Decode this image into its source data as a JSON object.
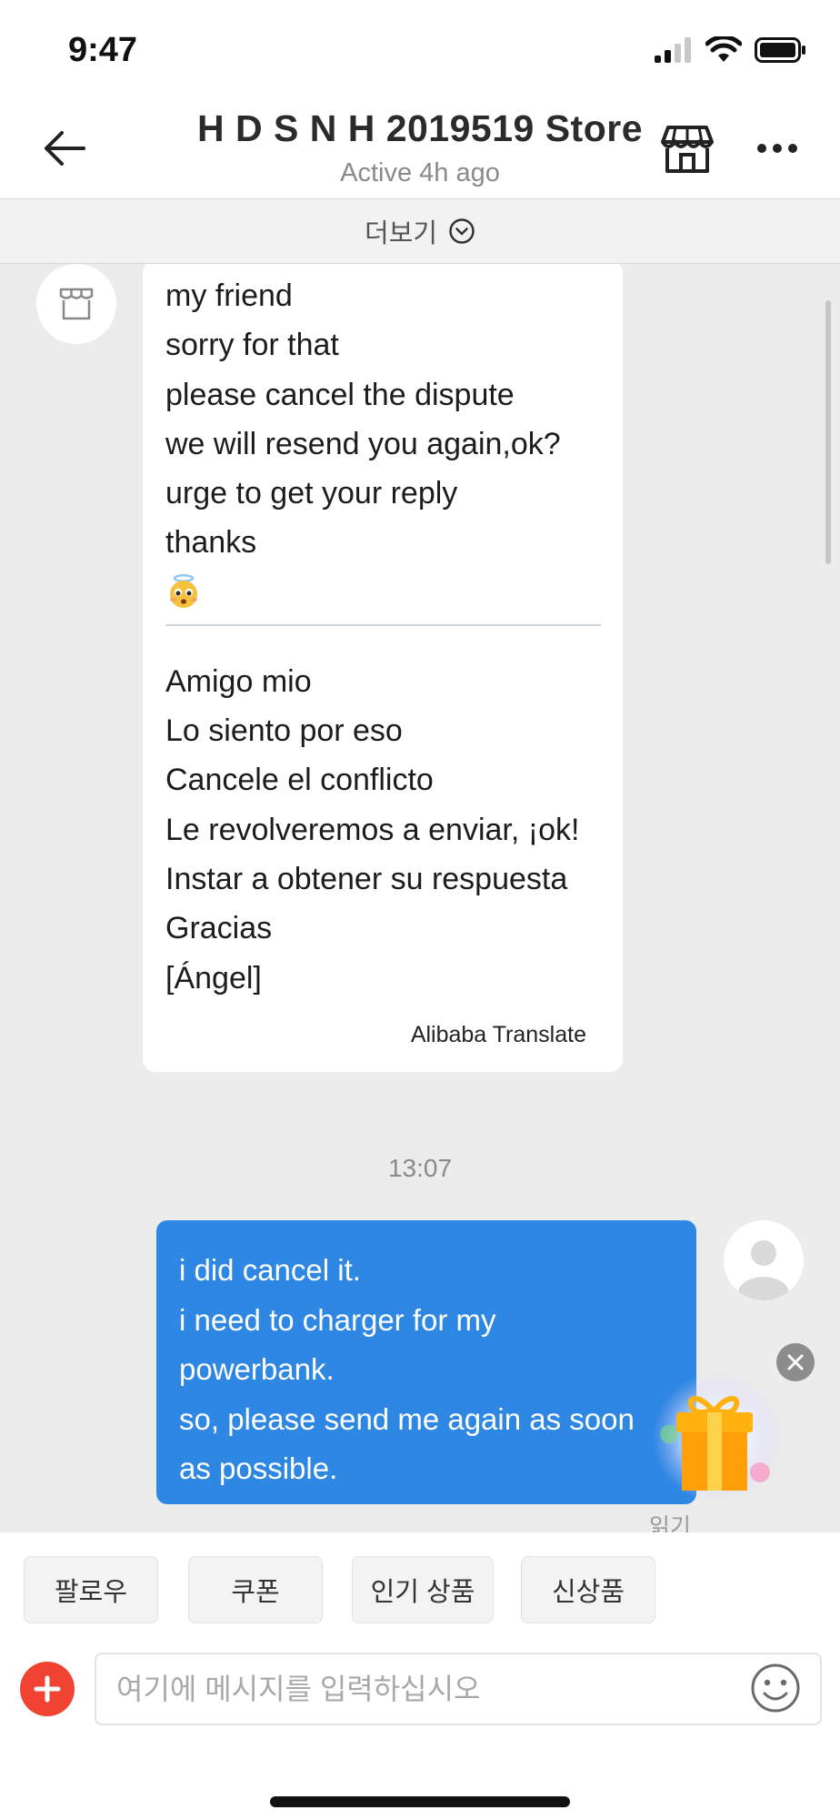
{
  "status_bar": {
    "time": "9:47"
  },
  "header": {
    "store_name": "H D S N H 2019519 Store",
    "active_status": "Active 4h ago"
  },
  "more_bar": {
    "label": "더보기"
  },
  "messages": {
    "incoming": {
      "original_lines": [
        "my friend",
        "sorry for that",
        "please cancel the dispute",
        "we will resend you again,ok?",
        "urge to get your reply",
        "thanks"
      ],
      "translated_lines": [
        "Amigo mio",
        "Lo siento por eso",
        "Cancele el conflicto",
        "Le revolveremos a enviar, ¡ok!",
        "Instar a obtener su respuesta",
        "Gracias",
        "[Ángel]"
      ],
      "translation_credit": "Alibaba Translate"
    },
    "timestamp": "13:07",
    "outgoing": {
      "lines": [
        "i did cancel it.",
        "i need to charger for my",
        "powerbank.",
        "so, please send me again as soon",
        "as possible."
      ]
    },
    "read_status": "읽기"
  },
  "quick_actions": [
    "팔로우",
    "쿠폰",
    "인기 상품",
    "신상품"
  ],
  "composer": {
    "placeholder": "여기에 메시지를 입력하십시오",
    "value": ""
  },
  "colors": {
    "outgoing_bubble": "#2e87e2",
    "plus_button": "#f04332",
    "chat_background": "#ececec"
  },
  "icons": {
    "back": "arrow-left-icon",
    "store": "storefront-icon",
    "more": "ellipsis-icon",
    "expand": "chevron-down-circle-icon",
    "emoji": "smiley-icon",
    "gift": "gift-icon",
    "close": "close-icon",
    "add": "plus-icon"
  }
}
